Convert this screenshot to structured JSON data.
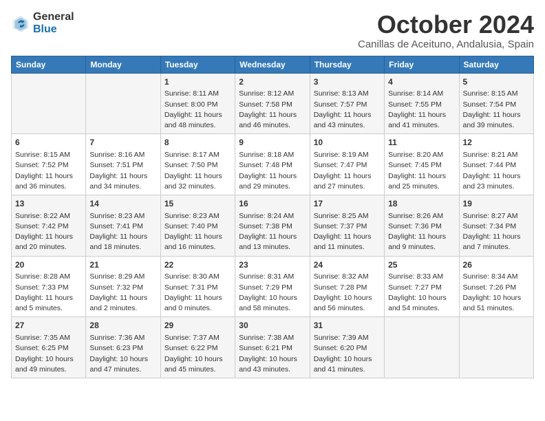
{
  "header": {
    "logo_general": "General",
    "logo_blue": "Blue",
    "month": "October 2024",
    "location": "Canillas de Aceituno, Andalusia, Spain"
  },
  "weekdays": [
    "Sunday",
    "Monday",
    "Tuesday",
    "Wednesday",
    "Thursday",
    "Friday",
    "Saturday"
  ],
  "weeks": [
    [
      {
        "day": "",
        "info": ""
      },
      {
        "day": "",
        "info": ""
      },
      {
        "day": "1",
        "info": "Sunrise: 8:11 AM\nSunset: 8:00 PM\nDaylight: 11 hours and 48 minutes."
      },
      {
        "day": "2",
        "info": "Sunrise: 8:12 AM\nSunset: 7:58 PM\nDaylight: 11 hours and 46 minutes."
      },
      {
        "day": "3",
        "info": "Sunrise: 8:13 AM\nSunset: 7:57 PM\nDaylight: 11 hours and 43 minutes."
      },
      {
        "day": "4",
        "info": "Sunrise: 8:14 AM\nSunset: 7:55 PM\nDaylight: 11 hours and 41 minutes."
      },
      {
        "day": "5",
        "info": "Sunrise: 8:15 AM\nSunset: 7:54 PM\nDaylight: 11 hours and 39 minutes."
      }
    ],
    [
      {
        "day": "6",
        "info": "Sunrise: 8:15 AM\nSunset: 7:52 PM\nDaylight: 11 hours and 36 minutes."
      },
      {
        "day": "7",
        "info": "Sunrise: 8:16 AM\nSunset: 7:51 PM\nDaylight: 11 hours and 34 minutes."
      },
      {
        "day": "8",
        "info": "Sunrise: 8:17 AM\nSunset: 7:50 PM\nDaylight: 11 hours and 32 minutes."
      },
      {
        "day": "9",
        "info": "Sunrise: 8:18 AM\nSunset: 7:48 PM\nDaylight: 11 hours and 29 minutes."
      },
      {
        "day": "10",
        "info": "Sunrise: 8:19 AM\nSunset: 7:47 PM\nDaylight: 11 hours and 27 minutes."
      },
      {
        "day": "11",
        "info": "Sunrise: 8:20 AM\nSunset: 7:45 PM\nDaylight: 11 hours and 25 minutes."
      },
      {
        "day": "12",
        "info": "Sunrise: 8:21 AM\nSunset: 7:44 PM\nDaylight: 11 hours and 23 minutes."
      }
    ],
    [
      {
        "day": "13",
        "info": "Sunrise: 8:22 AM\nSunset: 7:42 PM\nDaylight: 11 hours and 20 minutes."
      },
      {
        "day": "14",
        "info": "Sunrise: 8:23 AM\nSunset: 7:41 PM\nDaylight: 11 hours and 18 minutes."
      },
      {
        "day": "15",
        "info": "Sunrise: 8:23 AM\nSunset: 7:40 PM\nDaylight: 11 hours and 16 minutes."
      },
      {
        "day": "16",
        "info": "Sunrise: 8:24 AM\nSunset: 7:38 PM\nDaylight: 11 hours and 13 minutes."
      },
      {
        "day": "17",
        "info": "Sunrise: 8:25 AM\nSunset: 7:37 PM\nDaylight: 11 hours and 11 minutes."
      },
      {
        "day": "18",
        "info": "Sunrise: 8:26 AM\nSunset: 7:36 PM\nDaylight: 11 hours and 9 minutes."
      },
      {
        "day": "19",
        "info": "Sunrise: 8:27 AM\nSunset: 7:34 PM\nDaylight: 11 hours and 7 minutes."
      }
    ],
    [
      {
        "day": "20",
        "info": "Sunrise: 8:28 AM\nSunset: 7:33 PM\nDaylight: 11 hours and 5 minutes."
      },
      {
        "day": "21",
        "info": "Sunrise: 8:29 AM\nSunset: 7:32 PM\nDaylight: 11 hours and 2 minutes."
      },
      {
        "day": "22",
        "info": "Sunrise: 8:30 AM\nSunset: 7:31 PM\nDaylight: 11 hours and 0 minutes."
      },
      {
        "day": "23",
        "info": "Sunrise: 8:31 AM\nSunset: 7:29 PM\nDaylight: 10 hours and 58 minutes."
      },
      {
        "day": "24",
        "info": "Sunrise: 8:32 AM\nSunset: 7:28 PM\nDaylight: 10 hours and 56 minutes."
      },
      {
        "day": "25",
        "info": "Sunrise: 8:33 AM\nSunset: 7:27 PM\nDaylight: 10 hours and 54 minutes."
      },
      {
        "day": "26",
        "info": "Sunrise: 8:34 AM\nSunset: 7:26 PM\nDaylight: 10 hours and 51 minutes."
      }
    ],
    [
      {
        "day": "27",
        "info": "Sunrise: 7:35 AM\nSunset: 6:25 PM\nDaylight: 10 hours and 49 minutes."
      },
      {
        "day": "28",
        "info": "Sunrise: 7:36 AM\nSunset: 6:23 PM\nDaylight: 10 hours and 47 minutes."
      },
      {
        "day": "29",
        "info": "Sunrise: 7:37 AM\nSunset: 6:22 PM\nDaylight: 10 hours and 45 minutes."
      },
      {
        "day": "30",
        "info": "Sunrise: 7:38 AM\nSunset: 6:21 PM\nDaylight: 10 hours and 43 minutes."
      },
      {
        "day": "31",
        "info": "Sunrise: 7:39 AM\nSunset: 6:20 PM\nDaylight: 10 hours and 41 minutes."
      },
      {
        "day": "",
        "info": ""
      },
      {
        "day": "",
        "info": ""
      }
    ]
  ]
}
